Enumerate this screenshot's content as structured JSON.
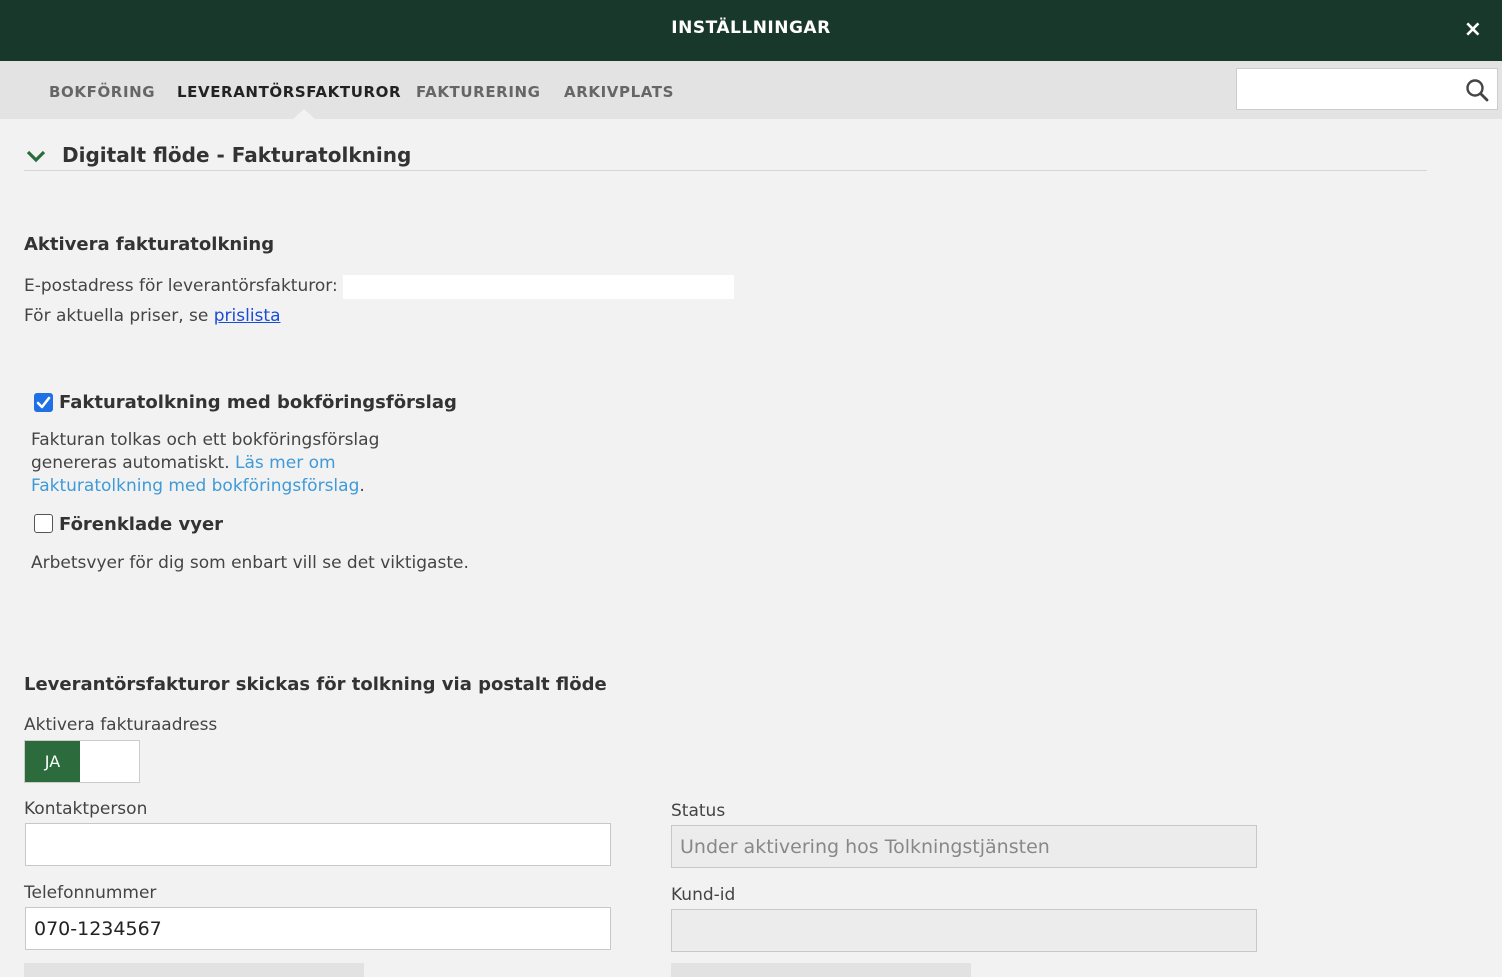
{
  "header": {
    "title": "INSTÄLLNINGAR",
    "close": "×"
  },
  "tabs": [
    {
      "label": "BOKFÖRING"
    },
    {
      "label": "LEVERANTÖRSFAKTUROR"
    },
    {
      "label": "FAKTURERING"
    },
    {
      "label": "ARKIVPLATS"
    }
  ],
  "active_tab": "LEVERANTÖRSFAKTUROR",
  "search": {
    "value": "",
    "placeholder": ""
  },
  "section": {
    "title": "Digitalt flöde - Fakturatolkning"
  },
  "activate": {
    "heading": "Aktivera fakturatolkning",
    "email_label": "E-postadress för leverantörsfakturor:",
    "price_prefix": "För aktuella priser, se ",
    "price_link": "prislista"
  },
  "options": {
    "booking": {
      "label": "Fakturatolkning med bokföringsförslag",
      "checked": true,
      "desc_line1": "Fakturan tolkas och ett bokföringsförslag",
      "desc_line2": "genereras automatiskt. ",
      "link_line1": "Läs mer om",
      "link_line2": "Fakturatolkning med bokföringsförslag",
      "desc_end": "."
    },
    "simplified": {
      "label": "Förenklade vyer",
      "checked": false,
      "desc": "Arbetsvyer för dig som enbart vill se det viktigaste."
    }
  },
  "postal": {
    "heading": "Leverantörsfakturor skickas för tolkning via postalt flöde",
    "activate_label": "Aktivera fakturaadress",
    "toggle_on": "JA"
  },
  "form": {
    "contact_label": "Kontaktperson",
    "contact_value": "",
    "phone_label": "Telefonnummer",
    "phone_value": "070-1234567",
    "status_label": "Status",
    "status_value": "Under aktivering hos Tolkningstjänsten",
    "customer_label": "Kund-id",
    "customer_value": ""
  },
  "colors": {
    "header_bg": "#17382a",
    "toggle_on": "#2b6b3c",
    "checkbox": "#1f6fe5",
    "link": "#3f9ad8"
  }
}
